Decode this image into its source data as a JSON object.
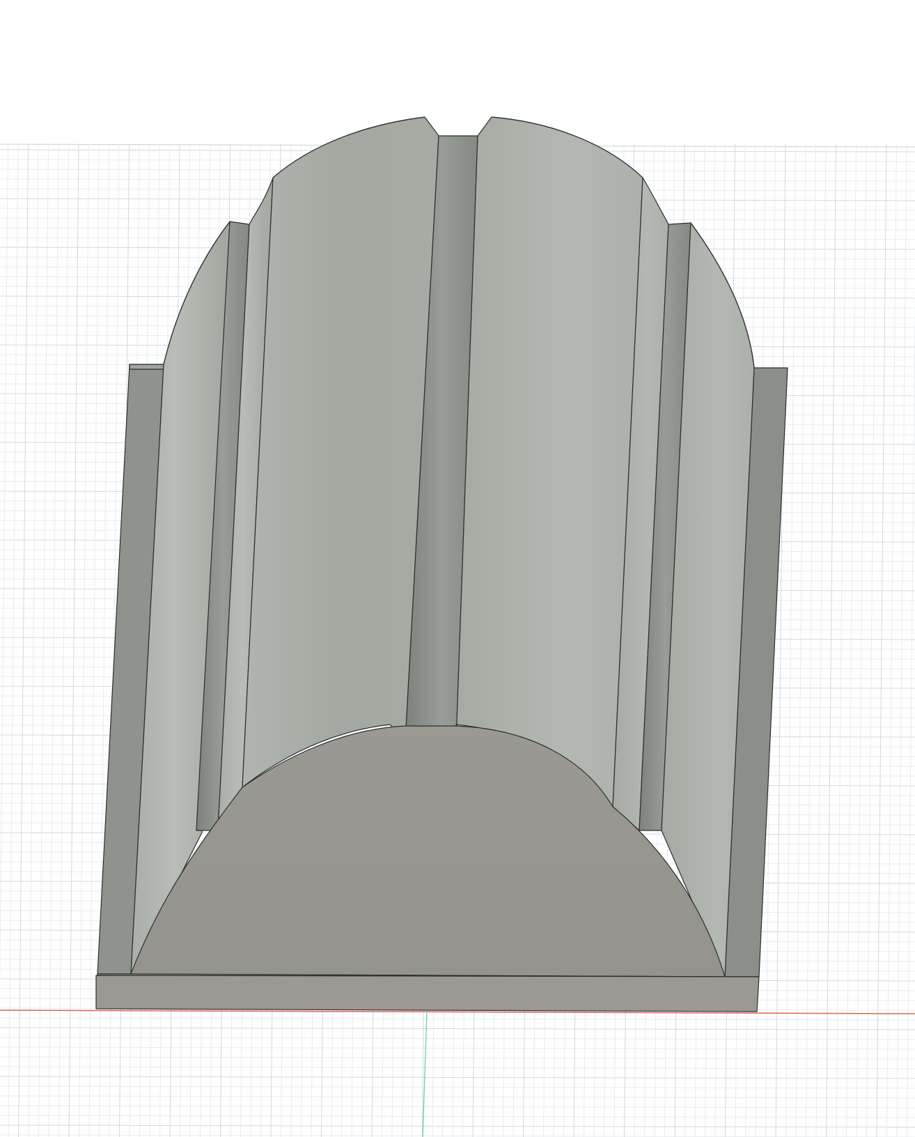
{
  "viewport": {
    "background_color": "#ffffff",
    "grid_minor_color": "#e8ecf0",
    "grid_major_color": "#d2d8de",
    "axis_x_color": "#e0605a",
    "axis_y_color": "#5fcf8f"
  },
  "model": {
    "outline_color": "#2b2e2c",
    "base_face_color": "#96958f",
    "base_front_color": "#9a9a92",
    "flute_light_color": "#b4b9b3",
    "flute_mid_color": "#a4a8a1",
    "groove_color": "#888c86",
    "groove_dark_color": "#71746f",
    "edge_plate_color": "#8d918b"
  }
}
